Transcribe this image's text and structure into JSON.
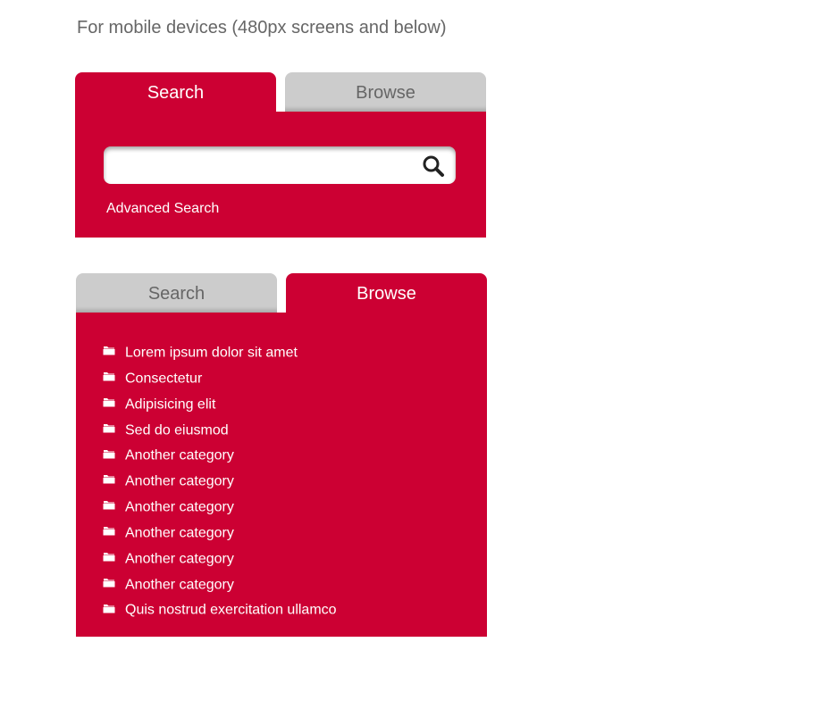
{
  "heading": "For mobile devices (480px screens and below)",
  "search_widget": {
    "tabs": [
      {
        "label": "Search",
        "active": true
      },
      {
        "label": "Browse",
        "active": false
      }
    ],
    "search_input": {
      "value": "",
      "placeholder": ""
    },
    "search_icon": "magnifier-icon",
    "advanced_search_label": "Advanced Search"
  },
  "browse_widget": {
    "tabs": [
      {
        "label": "Search",
        "active": false
      },
      {
        "label": "Browse",
        "active": true
      }
    ],
    "categories": [
      {
        "label": "Lorem ipsum dolor sit amet",
        "icon": "folder-icon"
      },
      {
        "label": "Consectetur",
        "icon": "folder-icon"
      },
      {
        "label": "Adipisicing elit",
        "icon": "folder-icon"
      },
      {
        "label": "Sed do eiusmod",
        "icon": "folder-icon"
      },
      {
        "label": "Another category",
        "icon": "folder-icon"
      },
      {
        "label": "Another category",
        "icon": "folder-icon"
      },
      {
        "label": "Another category",
        "icon": "folder-icon"
      },
      {
        "label": "Another category",
        "icon": "folder-icon"
      },
      {
        "label": "Another category",
        "icon": "folder-icon"
      },
      {
        "label": "Another category",
        "icon": "folder-icon"
      },
      {
        "label": "Quis nostrud exercitation ullamco",
        "icon": "folder-icon"
      }
    ]
  },
  "colors": {
    "accent": "#cc0033",
    "inactive_tab": "#cccccc",
    "inactive_tab_text": "#666666",
    "heading_text": "#666666"
  }
}
